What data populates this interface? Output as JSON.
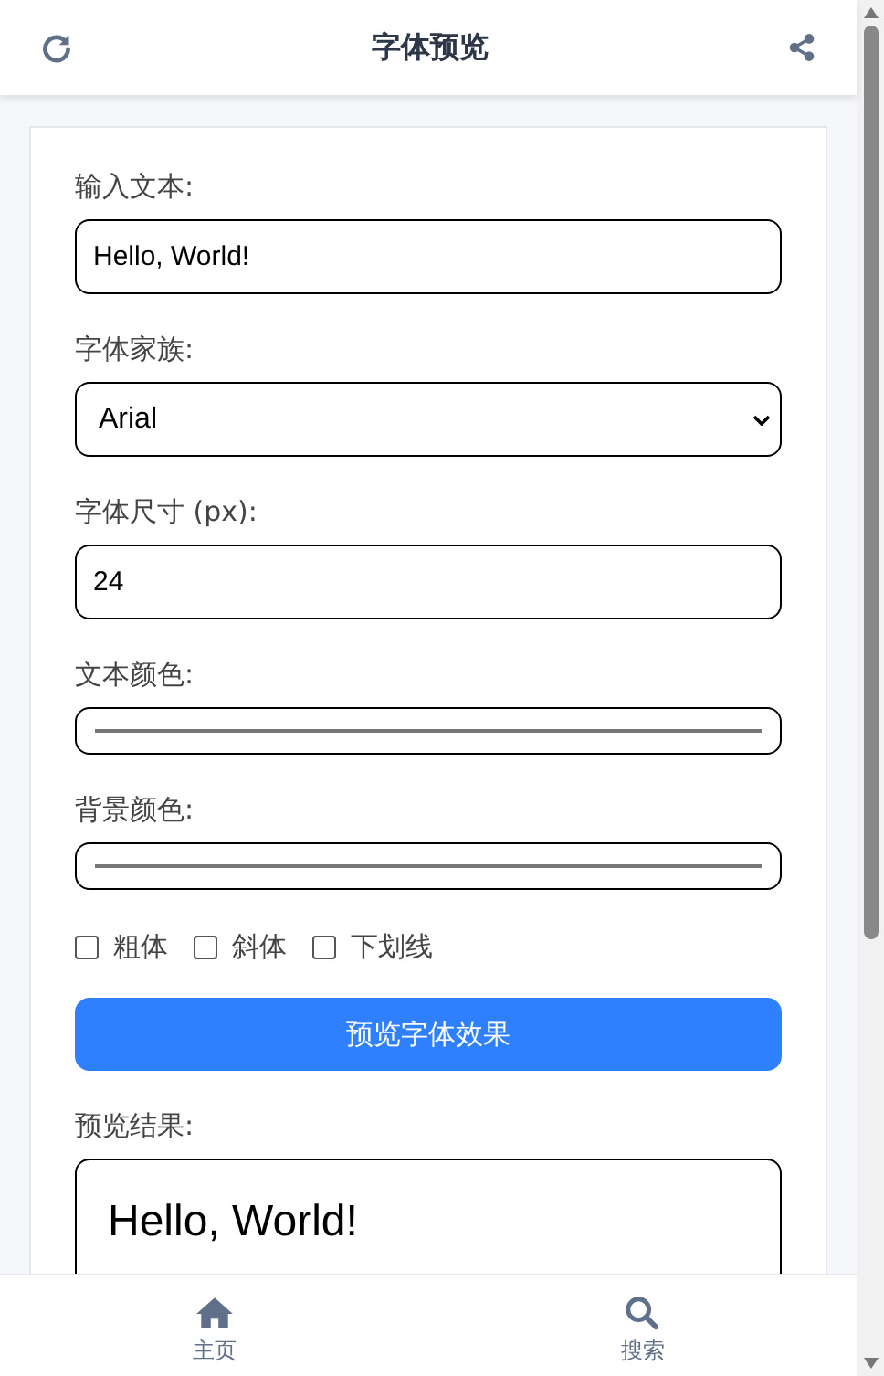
{
  "header": {
    "title": "字体预览"
  },
  "fields": [
    {
      "kind": "text",
      "label": "输入文本:",
      "value": "Hello, World!"
    },
    {
      "kind": "select",
      "label": "字体家族:",
      "value": "Arial"
    },
    {
      "kind": "text",
      "label": "字体尺寸 (px):",
      "value": "24"
    },
    {
      "kind": "color",
      "label": "文本颜色:"
    },
    {
      "kind": "color",
      "label": "背景颜色:"
    }
  ],
  "options": [
    {
      "label": "粗体",
      "checked": false
    },
    {
      "label": "斜体",
      "checked": false
    },
    {
      "label": "下划线",
      "checked": false
    }
  ],
  "button": "预览字体效果",
  "preview": {
    "label": "预览结果:",
    "text": "Hello, World!"
  },
  "nav": [
    {
      "kind": "home",
      "label": "主页",
      "selected": false
    },
    {
      "kind": "search",
      "label": "搜索",
      "selected": false
    }
  ]
}
